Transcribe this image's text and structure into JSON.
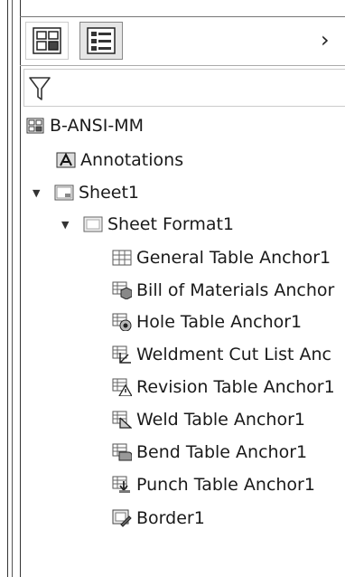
{
  "tree": {
    "root": "B-ANSI-MM",
    "annotations": "Annotations",
    "sheet": "Sheet1",
    "sheet_format": "Sheet Format1",
    "anchors": [
      {
        "label": "General Table Anchor1",
        "icon": "general-table-icon"
      },
      {
        "label": "Bill of Materials Anchor",
        "icon": "bom-table-icon"
      },
      {
        "label": "Hole Table Anchor1",
        "icon": "hole-table-icon"
      },
      {
        "label": "Weldment Cut List Anc",
        "icon": "cut-list-icon"
      },
      {
        "label": "Revision Table Anchor1",
        "icon": "revision-table-icon"
      },
      {
        "label": "Weld Table Anchor1",
        "icon": "weld-table-icon"
      },
      {
        "label": "Bend Table Anchor1",
        "icon": "bend-table-icon"
      },
      {
        "label": "Punch Table Anchor1",
        "icon": "punch-table-icon"
      },
      {
        "label": "Border1",
        "icon": "border-icon"
      }
    ]
  },
  "toolbar": {
    "expand_glyph": "›"
  }
}
